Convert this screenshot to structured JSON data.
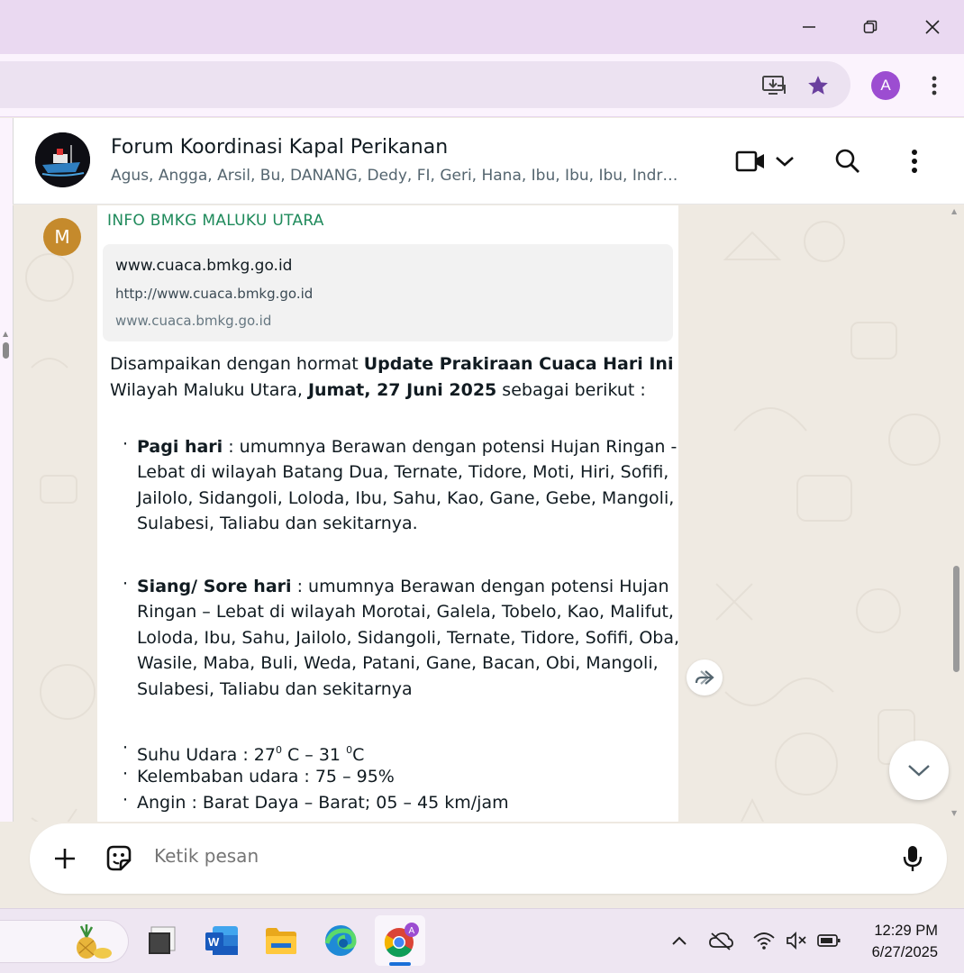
{
  "browser": {
    "profile_initial": "A",
    "icons": [
      "install-app-icon",
      "bookmark-star-icon",
      "more-vert-icon",
      "minimize-icon",
      "restore-icon",
      "close-icon"
    ],
    "accent_color": "#9c4dd1"
  },
  "chat": {
    "group_name": "Forum Koordinasi Kapal Perikanan",
    "members": "Agus, Angga, Arsil, Bu, DANANG, Dedy, FI, Geri, Hana, Ibu, Ibu, Ibu, Indr…",
    "sender_initial": "M",
    "sender_name": "INFO BMKG MALUKU UTARA",
    "sender_color": "#1f8a5b",
    "link_preview": {
      "title": "www.cuaca.bmkg.go.id",
      "url": "http://www.cuaca.bmkg.go.id",
      "domain": "www.cuaca.bmkg.go.id"
    },
    "intro": {
      "p1": "Disampaikan dengan hormat ",
      "b1": "Update Prakiraan Cuaca Hari Ini",
      "p2": "Wilayah Maluku Utara, ",
      "b2": "Jumat, 27 Juni 2025",
      "p3": " sebagai berikut :"
    },
    "morning": {
      "label": "Pagi hari",
      "line1": " : umumnya Berawan dengan potensi Hujan Ringan -",
      "line2": "Lebat di wilayah Batang Dua, Ternate, Tidore, Moti, Hiri, Sofifi,",
      "line3": "Jailolo, Sidangoli, Loloda, Ibu, Sahu, Kao, Gane, Gebe, Mangoli,",
      "line4": "Sulabesi, Taliabu dan sekitarnya."
    },
    "afternoon": {
      "label": "Siang/ Sore hari",
      "line1": " : umumnya Berawan dengan potensi Hujan",
      "line2": "Ringan – Lebat di wilayah Morotai, Galela, Tobelo, Kao, Malifut,",
      "line3": "Loloda, Ibu, Sahu, Jailolo, Sidangoli, Ternate, Tidore, Sofifi, Oba,",
      "line4": "Wasile, Maba, Buli, Weda, Patani, Gane, Bacan, Obi, Mangoli,",
      "line5": "Sulabesi, Taliabu dan sekitarnya"
    },
    "temperature": {
      "prefix": "Suhu Udara : 27",
      "sup1": "0",
      "mid": " C – 31 ",
      "sup2": "0",
      "suffix": "C"
    },
    "humidity": "Kelembaban udara : 75 – 95%",
    "wind": "Angin : Barat Daya – Barat; 05 – 45 km/jam",
    "compose_placeholder": "Ketik pesan"
  },
  "taskbar": {
    "apps": [
      "desktop-icon",
      "word-icon",
      "file-explorer-icon",
      "edge-icon",
      "chrome-icon"
    ],
    "time": "12:29 PM",
    "date": "6/27/2025"
  }
}
